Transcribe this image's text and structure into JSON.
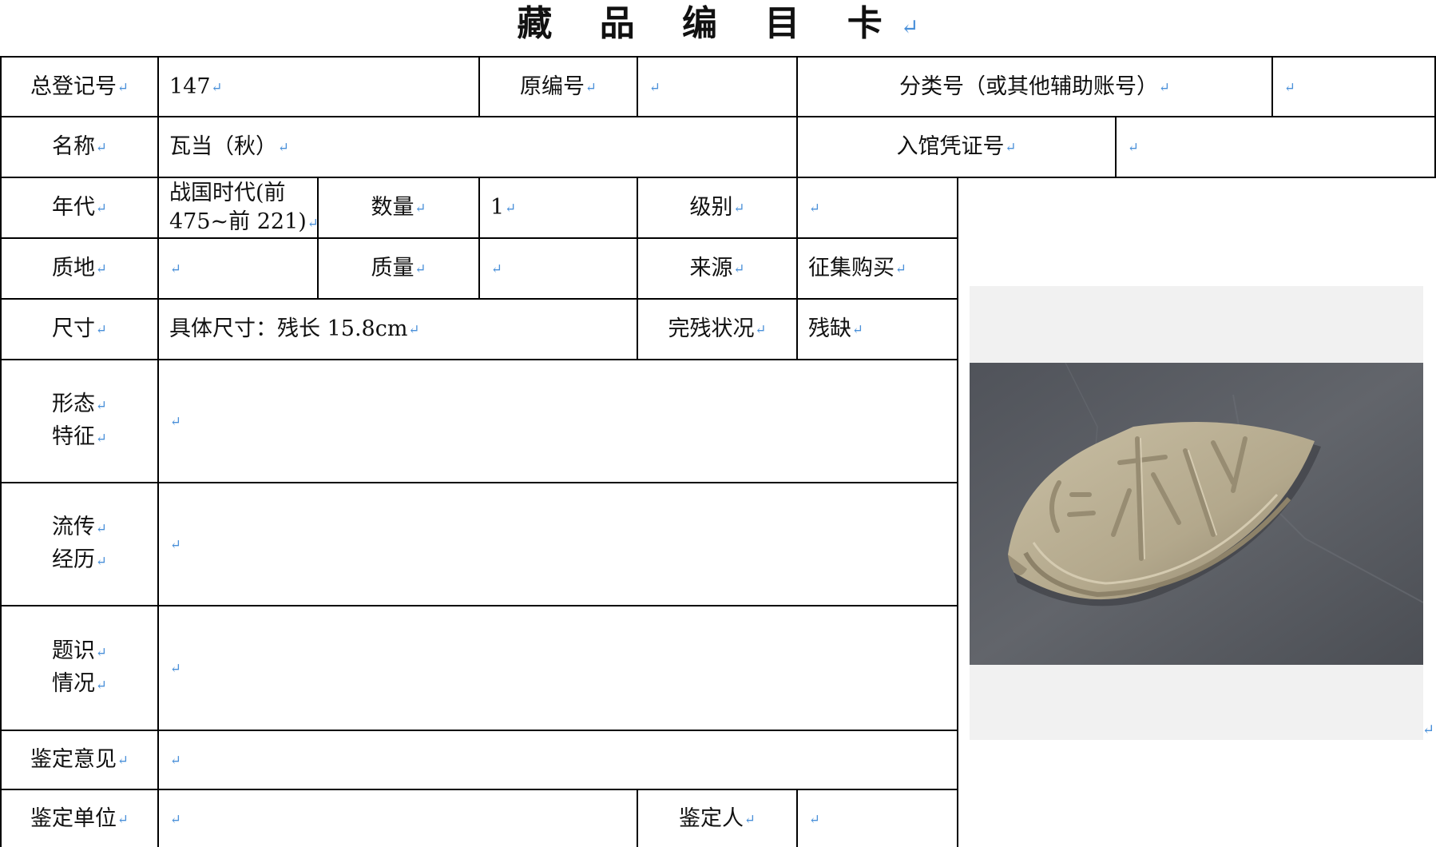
{
  "title": "藏 品 编 目 卡",
  "mark": "↵",
  "fields": {
    "reg_no_label": "总登记号",
    "reg_no_value": "147",
    "orig_no_label": "原编号",
    "orig_no_value": "",
    "class_no_label": "分类号（或其他辅助账号）",
    "class_no_value": "",
    "name_label": "名称",
    "name_value": "瓦当（秋）",
    "voucher_label": "入馆凭证号",
    "voucher_value": "",
    "era_label": "年代",
    "era_value_line1": "战国时代(前",
    "era_value_line2": "475~前 221)",
    "qty_label": "数量",
    "qty_value": "1",
    "grade_label": "级别",
    "grade_value": "",
    "material_label": "质地",
    "material_value": "",
    "weight_label": "质量",
    "weight_value": "",
    "source_label": "来源",
    "source_value": "征集购买",
    "size_label": "尺寸",
    "size_value": "具体尺寸：残长 15.8cm",
    "condition_label": "完残状况",
    "condition_value": "残缺",
    "form_label_1": "形态",
    "form_label_2": "特征",
    "form_value": "",
    "history_label_1": "流传",
    "history_label_2": "经历",
    "history_value": "",
    "inscription_label_1": "题识",
    "inscription_label_2": "情况",
    "inscription_value": "",
    "opinion_label": "鉴定意见",
    "opinion_value": "",
    "unit_label": "鉴定单位",
    "unit_value": "",
    "appraiser_label": "鉴定人",
    "appraiser_value": ""
  },
  "photo": {
    "inscription": "秋",
    "colors": {
      "background": "#5d6066",
      "tile": "#b8ad92",
      "tile_shadow": "#7d735f"
    }
  }
}
